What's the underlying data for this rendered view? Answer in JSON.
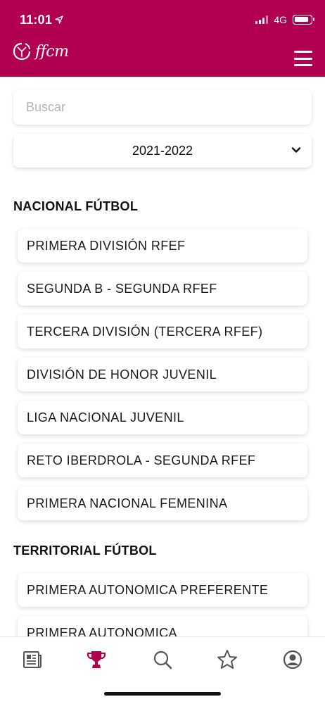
{
  "status_bar": {
    "time": "11:01",
    "network": "4G"
  },
  "app": {
    "logo_text": "ffcm",
    "brand_color": "#b0004f"
  },
  "search": {
    "placeholder": "Buscar"
  },
  "season_select": {
    "selected": "2021-2022",
    "icon": "chevron-down-icon"
  },
  "sections": [
    {
      "title": "NACIONAL FÚTBOL",
      "items": [
        "PRIMERA DIVISIÓN RFEF",
        "SEGUNDA B - SEGUNDA RFEF",
        "TERCERA DIVISIÓN (TERCERA RFEF)",
        "DIVISIÓN DE HONOR JUVENIL",
        "LIGA NACIONAL JUVENIL",
        "RETO IBERDROLA - SEGUNDA RFEF",
        "PRIMERA NACIONAL FEMENINA"
      ]
    },
    {
      "title": "TERRITORIAL FÚTBOL",
      "items": [
        "PRIMERA AUTONOMICA PREFERENTE",
        "PRIMERA AUTONOMICA"
      ]
    }
  ],
  "tab_bar": {
    "tabs": [
      {
        "icon": "news-icon",
        "active": false
      },
      {
        "icon": "trophy-icon",
        "active": true
      },
      {
        "icon": "search-icon",
        "active": false
      },
      {
        "icon": "star-icon",
        "active": false
      },
      {
        "icon": "profile-icon",
        "active": false
      }
    ],
    "active_color": "#b0004f",
    "inactive_color": "#555555"
  }
}
